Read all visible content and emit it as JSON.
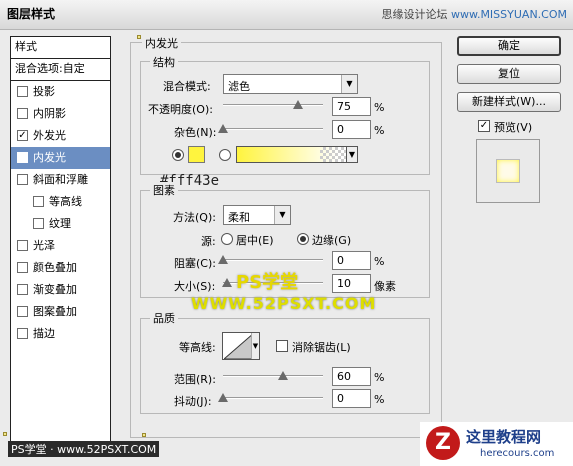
{
  "window": {
    "title": "图层样式",
    "watermark_top": "思缘设计论坛",
    "watermark_top_site": "www.MISSYUAN.COM"
  },
  "sidebar": {
    "header": "样式",
    "blend_options": "混合选项:自定",
    "items": [
      {
        "label": "投影",
        "checked": false,
        "indent": false,
        "selected": false
      },
      {
        "label": "内阴影",
        "checked": false,
        "indent": false,
        "selected": false
      },
      {
        "label": "外发光",
        "checked": true,
        "indent": false,
        "selected": false
      },
      {
        "label": "内发光",
        "checked": true,
        "indent": false,
        "selected": true
      },
      {
        "label": "斜面和浮雕",
        "checked": false,
        "indent": false,
        "selected": false
      },
      {
        "label": "等高线",
        "checked": false,
        "indent": true,
        "selected": false
      },
      {
        "label": "纹理",
        "checked": false,
        "indent": true,
        "selected": false
      },
      {
        "label": "光泽",
        "checked": false,
        "indent": false,
        "selected": false
      },
      {
        "label": "颜色叠加",
        "checked": false,
        "indent": false,
        "selected": false
      },
      {
        "label": "渐变叠加",
        "checked": false,
        "indent": false,
        "selected": false
      },
      {
        "label": "图案叠加",
        "checked": false,
        "indent": false,
        "selected": false
      },
      {
        "label": "描边",
        "checked": false,
        "indent": false,
        "selected": false
      }
    ]
  },
  "panel": {
    "title": "内发光",
    "structure": {
      "legend": "结构",
      "blend_mode_label": "混合模式:",
      "blend_mode_value": "滤色",
      "opacity_label": "不透明度(O):",
      "opacity_value": "75",
      "opacity_level": 75,
      "noise_label": "杂色(N):",
      "noise_value": "0",
      "noise_level": 0,
      "percent": "%",
      "glow_color": "#fff43e"
    },
    "hex_note": "#fff43e",
    "elements": {
      "legend": "图素",
      "technique_label": "方法(Q):",
      "technique_value": "柔和",
      "source_label": "源:",
      "source_center": "居中(E)",
      "source_edge": "边缘(G)",
      "choke_label": "阻塞(C):",
      "choke_value": "0",
      "choke_level": 0,
      "size_label": "大小(S):",
      "size_value": "10",
      "size_level": 4,
      "size_unit": "像素"
    },
    "quality": {
      "legend": "品质",
      "contour_label": "等高线:",
      "antialias_label": "消除锯齿(L)",
      "range_label": "范围(R):",
      "range_value": "60",
      "range_level": 60,
      "jitter_label": "抖动(J):",
      "jitter_value": "0",
      "jitter_level": 0
    }
  },
  "buttons": {
    "ok": "确定",
    "reset": "复位",
    "new_style": "新建样式(W)...",
    "preview_label": "预览(V)"
  },
  "watermarks": {
    "mid": "PS学堂",
    "mid2": "WWW.52PSXT.COM",
    "bottom_left": "PS学堂 · www.52PSXT.COM",
    "br_title": "这里教程网",
    "br_site": "herecours.com"
  },
  "colors": {
    "selection": "#6b8ec2",
    "glow": "#fff43e"
  }
}
